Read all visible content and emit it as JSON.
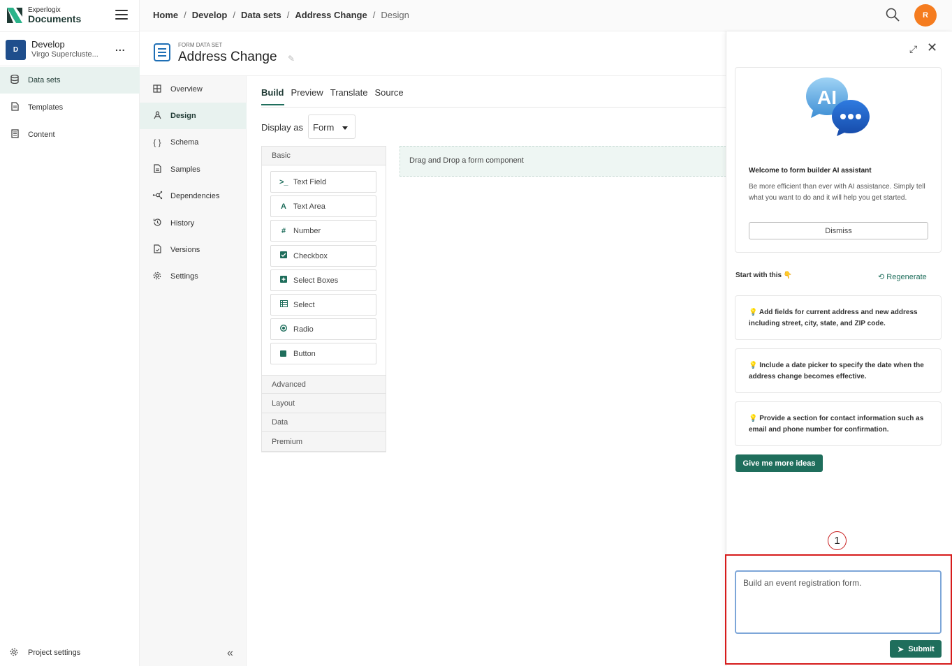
{
  "app": {
    "brand_top": "Experlogix",
    "brand_main": "Documents"
  },
  "project": {
    "initial": "D",
    "name": "Develop",
    "subtitle": "Virgo Supercluste...",
    "more": "..."
  },
  "sidebar": {
    "items": [
      {
        "label": "Data sets",
        "icon": "database-icon",
        "active": true
      },
      {
        "label": "Templates",
        "icon": "document-icon",
        "active": false
      },
      {
        "label": "Content",
        "icon": "content-icon",
        "active": false
      }
    ],
    "project_settings": "Project settings"
  },
  "breadcrumb": [
    "Home",
    "Develop",
    "Data sets",
    "Address Change",
    "Design"
  ],
  "user": {
    "initial": "R",
    "color": "#f57c1f"
  },
  "page": {
    "kind": "FORM DATA SET",
    "title": "Address Change"
  },
  "subnav": {
    "items": [
      {
        "label": "Overview",
        "icon": "grid-icon"
      },
      {
        "label": "Design",
        "icon": "design-icon"
      },
      {
        "label": "Schema",
        "icon": "braces-icon"
      },
      {
        "label": "Samples",
        "icon": "file-icon"
      },
      {
        "label": "Dependencies",
        "icon": "graph-icon"
      },
      {
        "label": "History",
        "icon": "history-icon"
      },
      {
        "label": "Versions",
        "icon": "versions-icon"
      },
      {
        "label": "Settings",
        "icon": "gear-icon"
      }
    ],
    "active": "Design"
  },
  "builder": {
    "tabs": [
      "Build",
      "Preview",
      "Translate",
      "Source"
    ],
    "active_tab": "Build",
    "display_as_label": "Display as",
    "display_as_value": "Form",
    "groups": {
      "basic": "Basic",
      "advanced": "Advanced",
      "layout": "Layout",
      "data": "Data",
      "premium": "Premium"
    },
    "components": [
      {
        "label": "Text Field",
        "icon": "terminal-icon"
      },
      {
        "label": "Text Area",
        "icon": "font-icon"
      },
      {
        "label": "Number",
        "icon": "hash-icon"
      },
      {
        "label": "Checkbox",
        "icon": "checkbox-icon"
      },
      {
        "label": "Select Boxes",
        "icon": "plus-square-icon"
      },
      {
        "label": "Select",
        "icon": "list-icon"
      },
      {
        "label": "Radio",
        "icon": "radio-icon"
      },
      {
        "label": "Button",
        "icon": "stop-icon"
      }
    ],
    "dropzone_text": "Drag and Drop a form component"
  },
  "ai_panel": {
    "welcome_title": "Welcome to form builder AI assistant",
    "welcome_text": "Be more efficient than ever with AI assistance. Simply tell what you want to do and it will help you get started.",
    "dismiss_label": "Dismiss",
    "start_label": "Start with this 👇",
    "regenerate_label": "Regenerate",
    "ideas": [
      "💡 Add fields for current address and new address including street, city, state, and ZIP code.",
      "💡 Include a date picker to specify the date when the address change becomes effective.",
      "💡 Provide a section for contact information such as email and phone number for confirmation."
    ],
    "more_ideas_label": "Give me more ideas",
    "marker": "1",
    "prompt_value": "Build an event registration form.",
    "submit_label": "Submit",
    "ai_badge": "AI",
    "accent": "#1f6e5c",
    "highlight": "#d61b1b"
  }
}
